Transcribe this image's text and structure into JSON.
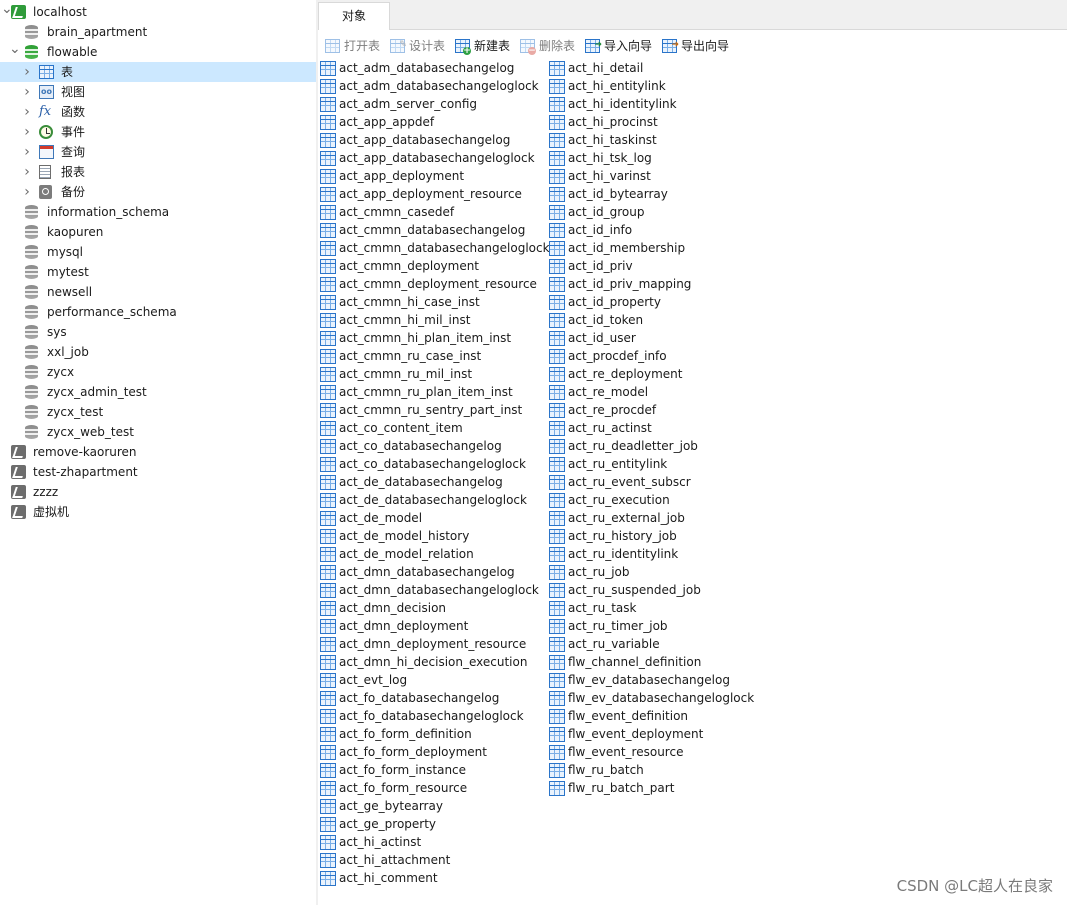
{
  "sidebar": {
    "tree": [
      {
        "label": "localhost",
        "icon": "connection-icon",
        "kind": "conn",
        "level": 0,
        "expanded": true
      },
      {
        "label": "brain_apartment",
        "icon": "database-icon",
        "kind": "db",
        "level": 1
      },
      {
        "label": "flowable",
        "icon": "database-icon",
        "kind": "db-open",
        "level": 1,
        "expanded": true
      },
      {
        "label": "表",
        "icon": "table-icon",
        "kind": "table",
        "level": 2,
        "selected": true
      },
      {
        "label": "视图",
        "icon": "view-icon",
        "kind": "view",
        "level": 2
      },
      {
        "label": "函数",
        "icon": "function-icon",
        "kind": "func",
        "level": 2
      },
      {
        "label": "事件",
        "icon": "event-icon",
        "kind": "event",
        "level": 2
      },
      {
        "label": "查询",
        "icon": "query-icon",
        "kind": "query",
        "level": 2
      },
      {
        "label": "报表",
        "icon": "report-icon",
        "kind": "report",
        "level": 2
      },
      {
        "label": "备份",
        "icon": "backup-icon",
        "kind": "backup",
        "level": 2
      },
      {
        "label": "information_schema",
        "icon": "database-icon",
        "kind": "db",
        "level": 1
      },
      {
        "label": "kaopuren",
        "icon": "database-icon",
        "kind": "db",
        "level": 1
      },
      {
        "label": "mysql",
        "icon": "database-icon",
        "kind": "db",
        "level": 1
      },
      {
        "label": "mytest",
        "icon": "database-icon",
        "kind": "db",
        "level": 1
      },
      {
        "label": "newsell",
        "icon": "database-icon",
        "kind": "db",
        "level": 1
      },
      {
        "label": "performance_schema",
        "icon": "database-icon",
        "kind": "db",
        "level": 1
      },
      {
        "label": "sys",
        "icon": "database-icon",
        "kind": "db",
        "level": 1
      },
      {
        "label": "xxl_job",
        "icon": "database-icon",
        "kind": "db",
        "level": 1
      },
      {
        "label": "zycx",
        "icon": "database-icon",
        "kind": "db",
        "level": 1
      },
      {
        "label": "zycx_admin_test",
        "icon": "database-icon",
        "kind": "db",
        "level": 1
      },
      {
        "label": "zycx_test",
        "icon": "database-icon",
        "kind": "db",
        "level": 1
      },
      {
        "label": "zycx_web_test",
        "icon": "database-icon",
        "kind": "db",
        "level": 1
      },
      {
        "label": "remove-kaoruren",
        "icon": "connection-icon",
        "kind": "conn-gray",
        "level": 0
      },
      {
        "label": "test-zhapartment",
        "icon": "connection-icon",
        "kind": "conn-gray",
        "level": 0
      },
      {
        "label": "zzzz",
        "icon": "connection-icon",
        "kind": "conn-gray",
        "level": 0
      },
      {
        "label": "虚拟机",
        "icon": "connection-icon",
        "kind": "conn-gray",
        "level": 0
      }
    ]
  },
  "main": {
    "tab_label": "对象",
    "toolbar": [
      {
        "label": "打开表",
        "icon": "open-table-icon",
        "enabled": false
      },
      {
        "label": "设计表",
        "icon": "design-table-icon",
        "enabled": false
      },
      {
        "label": "新建表",
        "icon": "new-table-icon",
        "enabled": true
      },
      {
        "label": "删除表",
        "icon": "delete-table-icon",
        "enabled": false
      },
      {
        "label": "导入向导",
        "icon": "import-wizard-icon",
        "enabled": true
      },
      {
        "label": "导出向导",
        "icon": "export-wizard-icon",
        "enabled": true
      }
    ],
    "tables_col1": [
      "act_adm_databasechangelog",
      "act_adm_databasechangeloglock",
      "act_adm_server_config",
      "act_app_appdef",
      "act_app_databasechangelog",
      "act_app_databasechangeloglock",
      "act_app_deployment",
      "act_app_deployment_resource",
      "act_cmmn_casedef",
      "act_cmmn_databasechangelog",
      "act_cmmn_databasechangeloglock",
      "act_cmmn_deployment",
      "act_cmmn_deployment_resource",
      "act_cmmn_hi_case_inst",
      "act_cmmn_hi_mil_inst",
      "act_cmmn_hi_plan_item_inst",
      "act_cmmn_ru_case_inst",
      "act_cmmn_ru_mil_inst",
      "act_cmmn_ru_plan_item_inst",
      "act_cmmn_ru_sentry_part_inst",
      "act_co_content_item",
      "act_co_databasechangelog",
      "act_co_databasechangeloglock",
      "act_de_databasechangelog",
      "act_de_databasechangeloglock",
      "act_de_model",
      "act_de_model_history",
      "act_de_model_relation",
      "act_dmn_databasechangelog",
      "act_dmn_databasechangeloglock",
      "act_dmn_decision",
      "act_dmn_deployment",
      "act_dmn_deployment_resource",
      "act_dmn_hi_decision_execution",
      "act_evt_log",
      "act_fo_databasechangelog",
      "act_fo_databasechangeloglock",
      "act_fo_form_definition",
      "act_fo_form_deployment",
      "act_fo_form_instance",
      "act_fo_form_resource",
      "act_ge_bytearray",
      "act_ge_property",
      "act_hi_actinst",
      "act_hi_attachment",
      "act_hi_comment"
    ],
    "tables_col2": [
      "act_hi_detail",
      "act_hi_entitylink",
      "act_hi_identitylink",
      "act_hi_procinst",
      "act_hi_taskinst",
      "act_hi_tsk_log",
      "act_hi_varinst",
      "act_id_bytearray",
      "act_id_group",
      "act_id_info",
      "act_id_membership",
      "act_id_priv",
      "act_id_priv_mapping",
      "act_id_property",
      "act_id_token",
      "act_id_user",
      "act_procdef_info",
      "act_re_deployment",
      "act_re_model",
      "act_re_procdef",
      "act_ru_actinst",
      "act_ru_deadletter_job",
      "act_ru_entitylink",
      "act_ru_event_subscr",
      "act_ru_execution",
      "act_ru_external_job",
      "act_ru_history_job",
      "act_ru_identitylink",
      "act_ru_job",
      "act_ru_suspended_job",
      "act_ru_task",
      "act_ru_timer_job",
      "act_ru_variable",
      "flw_channel_definition",
      "flw_ev_databasechangelog",
      "flw_ev_databasechangeloglock",
      "flw_event_definition",
      "flw_event_deployment",
      "flw_event_resource",
      "flw_ru_batch",
      "flw_ru_batch_part"
    ]
  },
  "watermark": "CSDN @LC超人在良家"
}
